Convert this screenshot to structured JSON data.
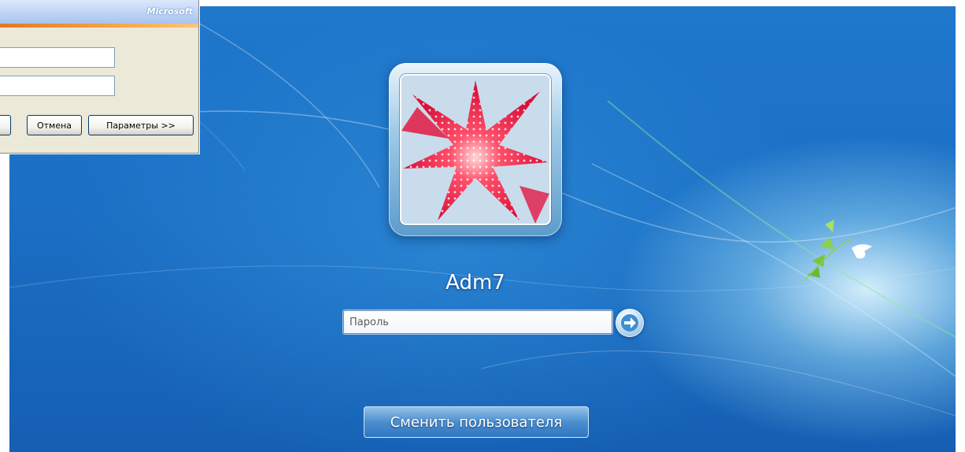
{
  "logon": {
    "username": "Adm7",
    "password_placeholder": "Пароль",
    "password_value": "",
    "switch_user_label": "Сменить пользователя",
    "submit_icon": "arrow-right-icon"
  },
  "xp_dialog": {
    "brand": "Microsoft",
    "fields": [
      {
        "value": ""
      },
      {
        "value": ""
      }
    ],
    "buttons": {
      "ok_label": "",
      "cancel_label": "Отмена",
      "options_label": "Параметры >>"
    }
  },
  "colors": {
    "background_blue": "#1b6fc4",
    "glow": "#dcf5ff",
    "xp_face": "#ece9d8",
    "xp_accent": "#e07a22"
  }
}
